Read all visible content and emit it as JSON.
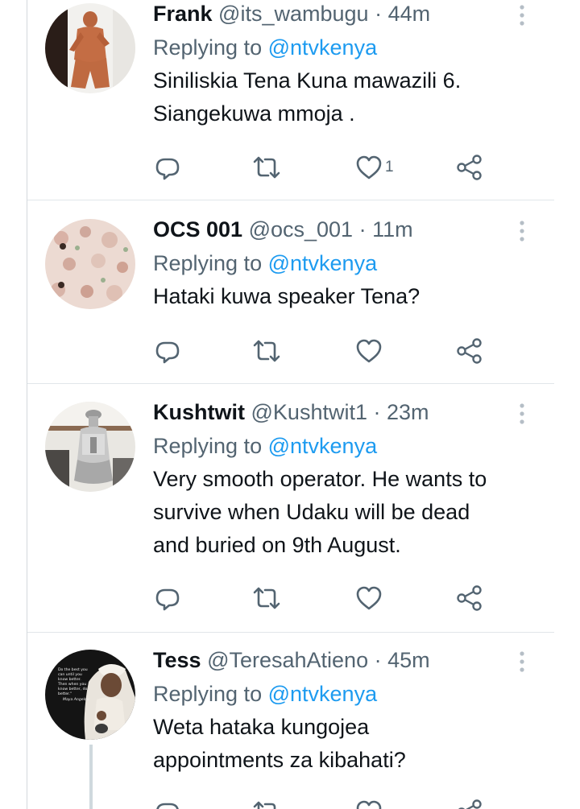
{
  "colors": {
    "text_primary": "#0f1419",
    "text_secondary": "#536471",
    "accent": "#1d9bf0",
    "divider": "#e1e6ea"
  },
  "tweets": [
    {
      "name": "Frank",
      "handle": "@its_wambugu",
      "separator": "·",
      "time": "44m",
      "replying_prefix": "Replying to",
      "replying_to": "@ntvkenya",
      "text_lines": [
        "Siniliskia Tena Kuna mawazili 6.",
        "Siangekuwa mmoja ."
      ],
      "like_count": "1",
      "avatar": "avatar-frank-icon"
    },
    {
      "name": "OCS 001",
      "handle": "@ocs_001",
      "separator": "·",
      "time": "11m",
      "replying_prefix": "Replying to",
      "replying_to": "@ntvkenya",
      "text_lines": [
        "Hataki kuwa speaker Tena?"
      ],
      "like_count": "",
      "avatar": "avatar-ocs-icon"
    },
    {
      "name": "Kushtwit",
      "handle": "@Kushtwit1",
      "separator": "·",
      "time": "23m",
      "replying_prefix": "Replying to",
      "replying_to": "@ntvkenya",
      "text_lines": [
        "Very smooth operator. He wants to",
        "survive when Udaku will be dead",
        "and buried on 9th August."
      ],
      "like_count": "",
      "avatar": "avatar-kushtwit-icon"
    },
    {
      "name": "Tess",
      "handle": "@TeresahAtieno",
      "separator": "·",
      "time": "45m",
      "replying_prefix": "Replying to",
      "replying_to": "@ntvkenya",
      "text_lines": [
        "Weta hataka kungojea",
        "appointments za kibahati?"
      ],
      "like_count": "",
      "avatar": "avatar-tess-icon",
      "avatar_quote_lines": [
        "Do the best you",
        "can until you",
        "know better.",
        "Then when you",
        "know better, do",
        "better.\"",
        "Maya Angelou"
      ]
    }
  ]
}
